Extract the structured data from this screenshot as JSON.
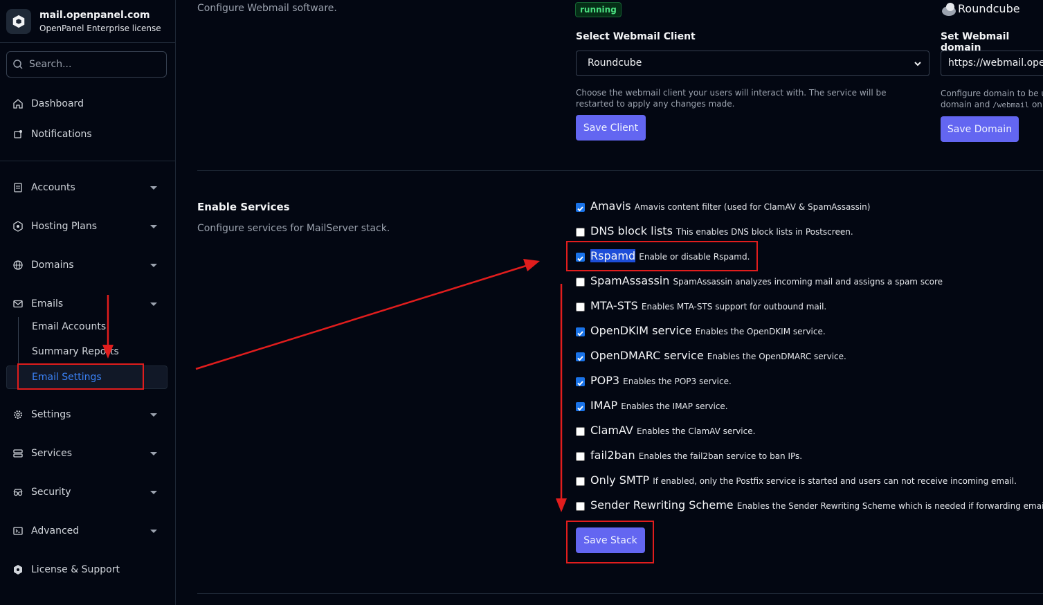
{
  "sidebar": {
    "brand_title": "mail.openpanel.com",
    "brand_subtitle": "OpenPanel Enterprise license",
    "search_placeholder": "Search...",
    "items": [
      {
        "label": "Dashboard",
        "icon": "home-icon"
      },
      {
        "label": "Notifications",
        "icon": "bell-icon"
      },
      {
        "label": "Accounts",
        "icon": "accounts-icon"
      },
      {
        "label": "Hosting Plans",
        "icon": "plans-icon"
      },
      {
        "label": "Domains",
        "icon": "globe-icon"
      },
      {
        "label": "Emails",
        "icon": "mail-icon"
      },
      {
        "label": "Settings",
        "icon": "gear-icon"
      },
      {
        "label": "Services",
        "icon": "server-icon"
      },
      {
        "label": "Security",
        "icon": "security-icon"
      },
      {
        "label": "Advanced",
        "icon": "terminal-icon"
      },
      {
        "label": "License & Support",
        "icon": "license-icon"
      }
    ],
    "email_subitems": [
      "Email Accounts",
      "Summary Reports",
      "Email Settings"
    ]
  },
  "webmail": {
    "description": "Configure Webmail software.",
    "status": "running",
    "current_client": "Roundcube",
    "client_label": "Select Webmail Client",
    "client_value": "Roundcube",
    "client_help": "Choose the webmail client your users will interact with. The service will be restarted to apply any changes made.",
    "save_client": "Save Client",
    "domain_label": "Set Webmail domain",
    "domain_value": "https://webmail.openpanel.com",
    "domain_help_1": "Configure domain to be us",
    "domain_help_2a": "domain and ",
    "domain_help_code": "/webmail",
    "domain_help_2b": " on",
    "save_domain": "Save Domain"
  },
  "services": {
    "title": "Enable Services",
    "description": "Configure services for MailServer stack.",
    "items": [
      {
        "name": "Amavis",
        "desc": "Amavis content filter (used for ClamAV & SpamAssassin)",
        "checked": true
      },
      {
        "name": "DNS block lists",
        "desc": "This enables DNS block lists in Postscreen.",
        "checked": false
      },
      {
        "name": "Rspamd",
        "desc": "Enable or disable Rspamd.",
        "checked": true
      },
      {
        "name": "SpamAssassin",
        "desc": "SpamAssassin analyzes incoming mail and assigns a spam score",
        "checked": false
      },
      {
        "name": "MTA-STS",
        "desc": "Enables MTA-STS support for outbound mail.",
        "checked": false
      },
      {
        "name": "OpenDKIM service",
        "desc": "Enables the OpenDKIM service.",
        "checked": true
      },
      {
        "name": "OpenDMARC service",
        "desc": "Enables the OpenDMARC service.",
        "checked": true
      },
      {
        "name": "POP3",
        "desc": "Enables the POP3 service.",
        "checked": true
      },
      {
        "name": "IMAP",
        "desc": "Enables the IMAP service.",
        "checked": true
      },
      {
        "name": "ClamAV",
        "desc": "Enables the ClamAV service.",
        "checked": false
      },
      {
        "name": "fail2ban",
        "desc": "Enables the fail2ban service to ban IPs.",
        "checked": false
      },
      {
        "name": "Only SMTP",
        "desc": "If enabled, only the Postfix service is started and users can not receive incoming email.",
        "checked": false
      },
      {
        "name": "Sender Rewriting Scheme",
        "desc": "Enables the Sender Rewriting Scheme which is needed if forwarding emails",
        "checked": false
      }
    ],
    "save_stack": "Save Stack"
  },
  "colors": {
    "accent": "#6366f1",
    "link_active": "#3b82f6",
    "annotation": "#e11d1d",
    "running": "#4ade80"
  }
}
